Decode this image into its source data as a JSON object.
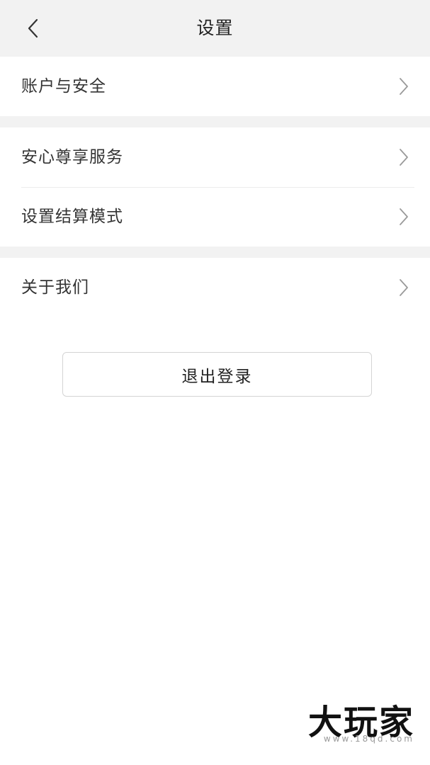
{
  "header": {
    "title": "设置",
    "back_icon": "chevron-left-icon"
  },
  "sections": [
    {
      "items": [
        {
          "label": "账户与安全",
          "icon": "chevron-right-icon"
        }
      ]
    },
    {
      "items": [
        {
          "label": "安心尊享服务",
          "icon": "chevron-right-icon"
        },
        {
          "label": "设置结算模式",
          "icon": "chevron-right-icon"
        }
      ]
    },
    {
      "items": [
        {
          "label": "关于我们",
          "icon": "chevron-right-icon"
        }
      ]
    }
  ],
  "logout_label": "退出登录",
  "watermark": {
    "main": "大玩家",
    "sub": "www.18qd.com"
  },
  "colors": {
    "background": "#ffffff",
    "section_gap": "#f2f2f2",
    "text": "#333333",
    "chevron": "#9a9a9a",
    "button_border": "#d4d4d4"
  }
}
